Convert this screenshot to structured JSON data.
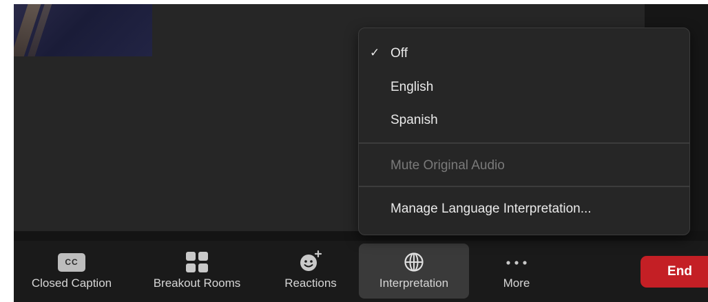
{
  "interpretation_menu": {
    "selected_check": "✓",
    "languages": [
      {
        "label": "Off",
        "selected": true
      },
      {
        "label": "English",
        "selected": false
      },
      {
        "label": "Spanish",
        "selected": false
      }
    ],
    "mute_original_audio": "Mute Original Audio",
    "manage_label": "Manage Language Interpretation..."
  },
  "toolbar": {
    "closed_caption": {
      "label": "Closed Caption",
      "icon_text": "CC",
      "icon": "closed-caption-icon"
    },
    "breakout_rooms": {
      "label": "Breakout Rooms",
      "icon": "grid-icon"
    },
    "reactions": {
      "label": "Reactions",
      "icon": "emoji-add-icon"
    },
    "interpretation": {
      "label": "Interpretation",
      "icon": "globe-icon"
    },
    "more": {
      "label": "More",
      "icon": "ellipsis-icon"
    },
    "end": {
      "label": "End"
    }
  },
  "colors": {
    "end_button": "#c41f25",
    "menu_background": "#262626",
    "toolbar_background": "#1a1a1a",
    "active_button": "#3a3a3a"
  }
}
